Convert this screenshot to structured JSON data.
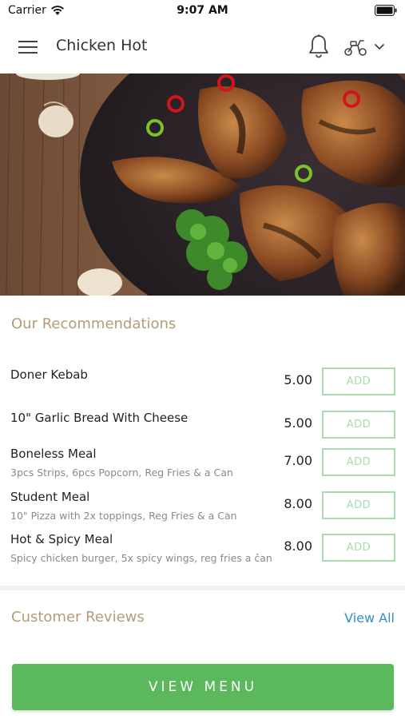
{
  "status_bar": {
    "carrier": "Carrier",
    "time": "9:07 AM"
  },
  "header": {
    "title": "Chicken Hot",
    "icons": [
      "menu-icon",
      "bell-icon",
      "scooter-icon",
      "chevron-down-icon"
    ]
  },
  "recommendations": {
    "title": "Our Recommendations",
    "items": [
      {
        "name": "Doner Kebab",
        "description": "",
        "price": "5.00",
        "add_label": "ADD"
      },
      {
        "name": "10\" Garlic Bread With Cheese",
        "description": "",
        "price": "5.00",
        "add_label": "ADD"
      },
      {
        "name": "Boneless Meal",
        "description": "3pcs Strips, 6pcs Popcorn, Reg Fries & a Can",
        "price": "7.00",
        "add_label": "ADD"
      },
      {
        "name": "Student Meal",
        "description": "10\" Pizza with 2x toppings, Reg Fries & a Can",
        "price": "8.00",
        "add_label": "ADD"
      },
      {
        "name": "Hot & Spicy Meal",
        "description": "Spicy chicken burger, 5x spicy wings, reg fries a čan",
        "price": "8.00",
        "add_label": "ADD"
      }
    ]
  },
  "reviews": {
    "title": "Customer Reviews",
    "view_all_label": "View All"
  },
  "footer": {
    "view_menu_label": "VIEW MENU"
  },
  "colors": {
    "accent_green": "#5cb85c",
    "add_border": "#a8dbb0",
    "section_title": "#b39d76",
    "link_blue": "#2b93c8"
  }
}
